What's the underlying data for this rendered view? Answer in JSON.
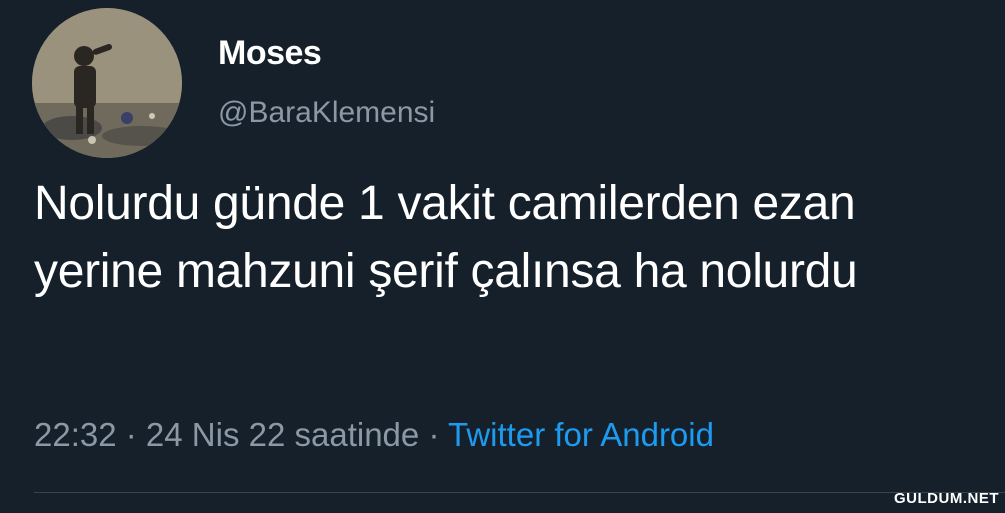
{
  "tweet": {
    "display_name": "Moses",
    "handle": "@BaraKlemensi",
    "text": "Nolurdu günde 1 vakit camilerden ezan yerine mahzuni şerif çalınsa ha nolurdu",
    "time": "22:32",
    "separator": " · ",
    "date": "24 Nis 22 saatinde",
    "source": "Twitter for Android"
  },
  "watermark": "GULDUM.NET",
  "colors": {
    "background": "#15202b",
    "text": "#ffffff",
    "secondary_text": "#8b98a5",
    "link": "#1d9bf0"
  }
}
